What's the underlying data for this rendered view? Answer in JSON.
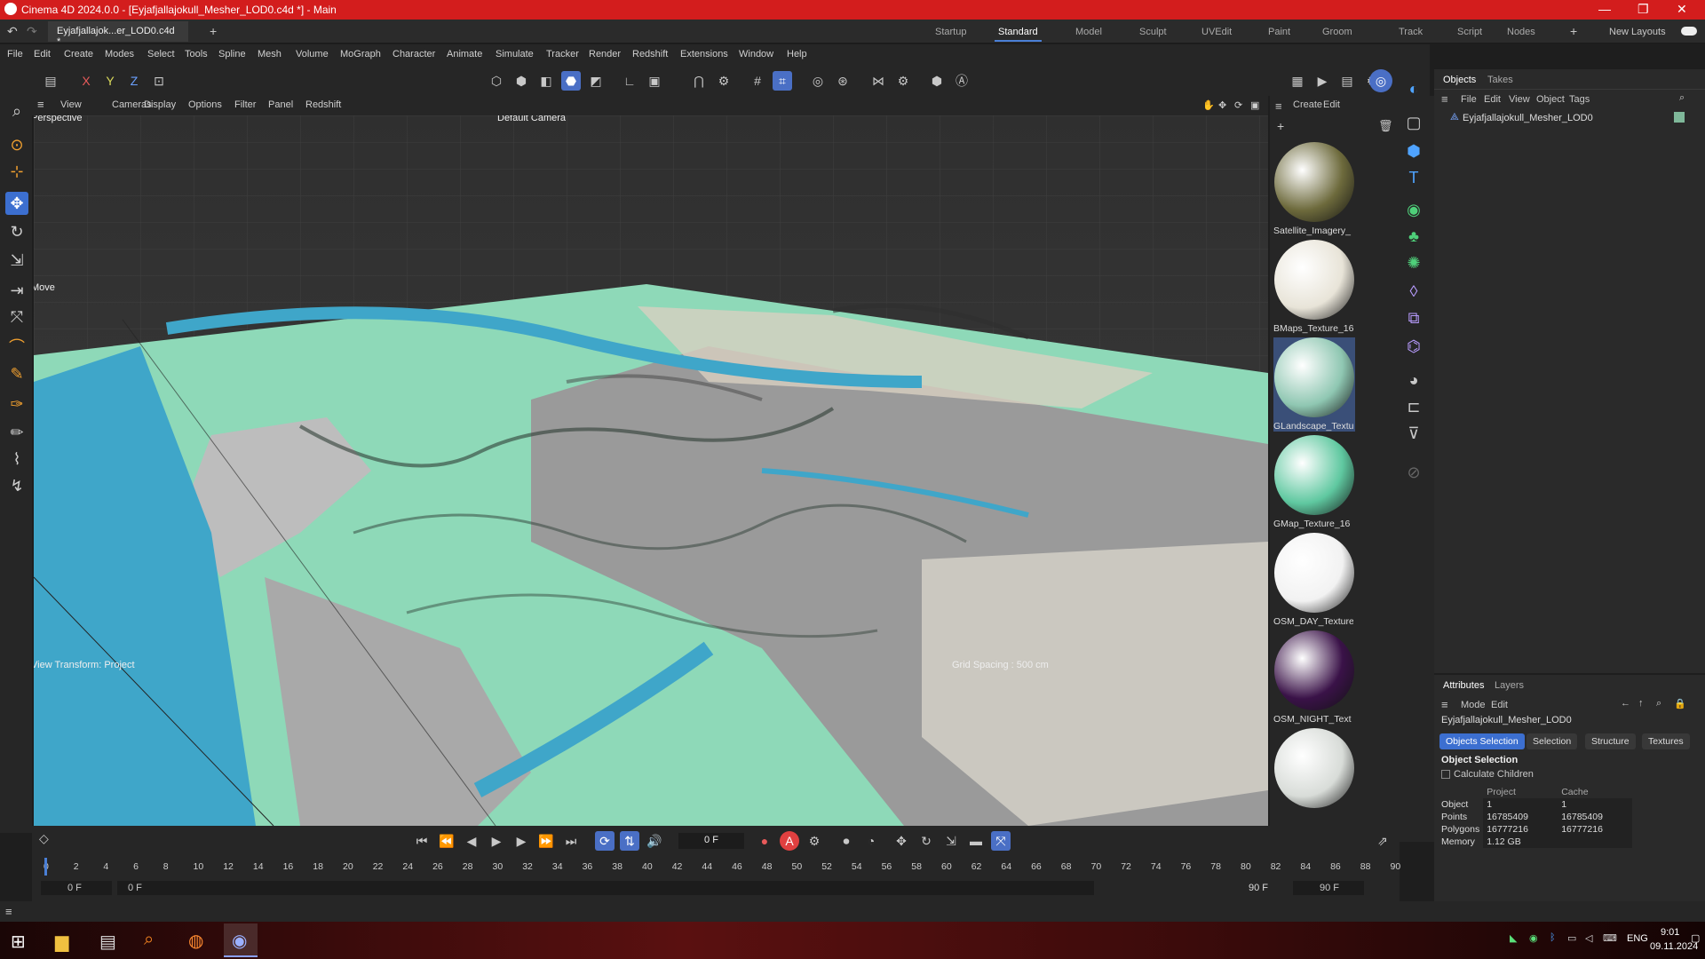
{
  "window": {
    "title": "Cinema 4D 2024.0.0 - [Eyjafjallajokull_Mesher_LOD0.c4d *] - Main"
  },
  "doc_tab": {
    "label": "Eyjafjallajok...er_LOD0.c4d *",
    "add": "+"
  },
  "layouts": [
    "Startup",
    "Standard",
    "Model",
    "Sculpt",
    "UVEdit",
    "Paint",
    "Groom",
    "Track",
    "Script",
    "Nodes"
  ],
  "layout_active": "Standard",
  "new_layouts": "New Layouts",
  "menu": [
    "File",
    "Edit",
    "Create",
    "Modes",
    "Select",
    "Tools",
    "Spline",
    "Mesh",
    "Volume",
    "MoGraph",
    "Character",
    "Animate",
    "Simulate",
    "Tracker",
    "Render",
    "Redshift",
    "Extensions",
    "Window",
    "Help"
  ],
  "axes": {
    "x": "X",
    "y": "Y",
    "z": "Z"
  },
  "view_menu": [
    "View",
    "Cameras",
    "Display",
    "Options",
    "Filter",
    "Panel",
    "Redshift"
  ],
  "viewport": {
    "name": "Perspective",
    "camera": "Default Camera",
    "move_label": "Move",
    "view_transform": "View Transform: Project",
    "grid_spacing": "Grid Spacing : 500 cm"
  },
  "mat_menu": {
    "create": "Create",
    "edit": "Edit"
  },
  "materials": [
    {
      "name": "Satellite_Imagery_",
      "color": "#6d6a3c"
    },
    {
      "name": "BMaps_Texture_16",
      "color": "#e8e4d8"
    },
    {
      "name": "GLandscape_Textu",
      "color": "#8fc7b2",
      "selected": true
    },
    {
      "name": "GMap_Texture_16",
      "color": "#5fc8a0"
    },
    {
      "name": "OSM_DAY_Texture",
      "color": "#f2f2f2"
    },
    {
      "name": "OSM_NIGHT_Text",
      "color": "#3a1248"
    },
    {
      "name": "",
      "color": "#d8dcd8"
    }
  ],
  "objects_panel": {
    "tabs": [
      "Objects",
      "Takes"
    ],
    "menu": [
      "File",
      "Edit",
      "View",
      "Object",
      "Tags"
    ],
    "items": [
      {
        "name": "Eyjafjallajokull_Mesher_LOD0"
      }
    ]
  },
  "attributes": {
    "tabs": [
      "Attributes",
      "Layers"
    ],
    "menu": [
      "Mode",
      "Edit"
    ],
    "object_name": "Eyjafjallajokull_Mesher_LOD0",
    "buttons": [
      "Objects Selection",
      "Selection",
      "Structure",
      "Textures"
    ],
    "section": "Object Selection",
    "checkbox_label": "Calculate Children",
    "columns": [
      "Project",
      "Cache"
    ],
    "rows": [
      {
        "label": "Object",
        "project": "1",
        "cache": "1"
      },
      {
        "label": "Points",
        "project": "16785409",
        "cache": "16785409"
      },
      {
        "label": "Polygons",
        "project": "16777216",
        "cache": "16777216"
      },
      {
        "label": "Memory",
        "project": "1.12 GB",
        "cache": ""
      }
    ]
  },
  "timeline": {
    "current_frame": "0 F",
    "start_field": "0 F",
    "start_field2": "0 F",
    "end_field": "90 F",
    "end_field2": "90 F",
    "ticks": [
      "0",
      "2",
      "4",
      "6",
      "8",
      "10",
      "12",
      "14",
      "16",
      "18",
      "20",
      "22",
      "24",
      "26",
      "28",
      "30",
      "32",
      "34",
      "36",
      "38",
      "40",
      "42",
      "44",
      "46",
      "48",
      "50",
      "52",
      "54",
      "56",
      "58",
      "60",
      "62",
      "64",
      "66",
      "68",
      "70",
      "72",
      "74",
      "76",
      "78",
      "80",
      "82",
      "84",
      "86",
      "88",
      "90"
    ]
  },
  "taskbar": {
    "lang": "ENG",
    "time": "9:01",
    "date": "09.11.2024"
  },
  "colors": {
    "title_red": "#d31d1d",
    "accent_blue": "#3c6fd0",
    "terrain_green": "#8ed9b8",
    "water_blue": "#3fa6c9"
  }
}
